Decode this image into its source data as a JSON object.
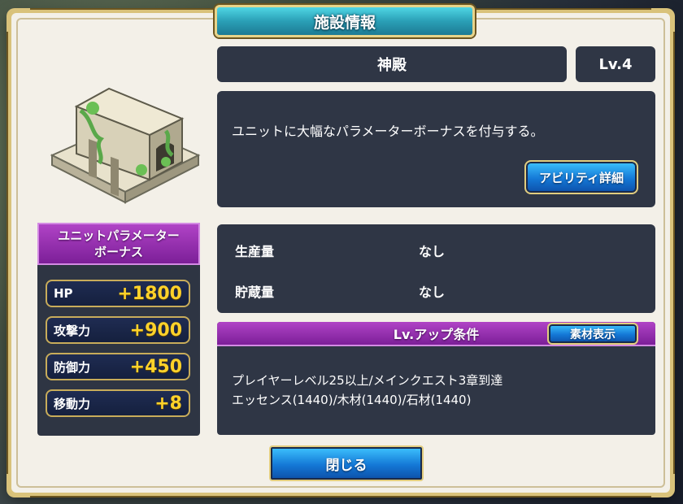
{
  "dialog": {
    "title": "施設情報"
  },
  "facility": {
    "name": "神殿",
    "level": "Lv.4",
    "description": "ユニットに大幅なパラメーターボーナスを付与する。"
  },
  "buttons": {
    "ability_detail": "アビリティ詳細",
    "material_view": "素材表示",
    "close": "閉じる"
  },
  "bonus_panel": {
    "title_line1": "ユニットパラメーター",
    "title_line2": "ボーナス",
    "stats": [
      {
        "label": "HP",
        "value": "+1800"
      },
      {
        "label": "攻撃力",
        "value": "+900"
      },
      {
        "label": "防御力",
        "value": "+450"
      },
      {
        "label": "移動力",
        "value": "+8"
      }
    ]
  },
  "production": {
    "rows": [
      {
        "label": "生産量",
        "value": "なし"
      },
      {
        "label": "貯蔵量",
        "value": "なし"
      }
    ]
  },
  "levelup": {
    "title": "Lv.アップ条件",
    "line1": "プレイヤーレベル25以上/メインクエスト3章到達",
    "line2": "エッセンス(1440)/木材(1440)/石材(1440)"
  },
  "colors": {
    "panel": "#2f3645",
    "accent_purple": "#9b35b5",
    "accent_blue": "#1f8fe6",
    "gold": "#ffd22a"
  }
}
